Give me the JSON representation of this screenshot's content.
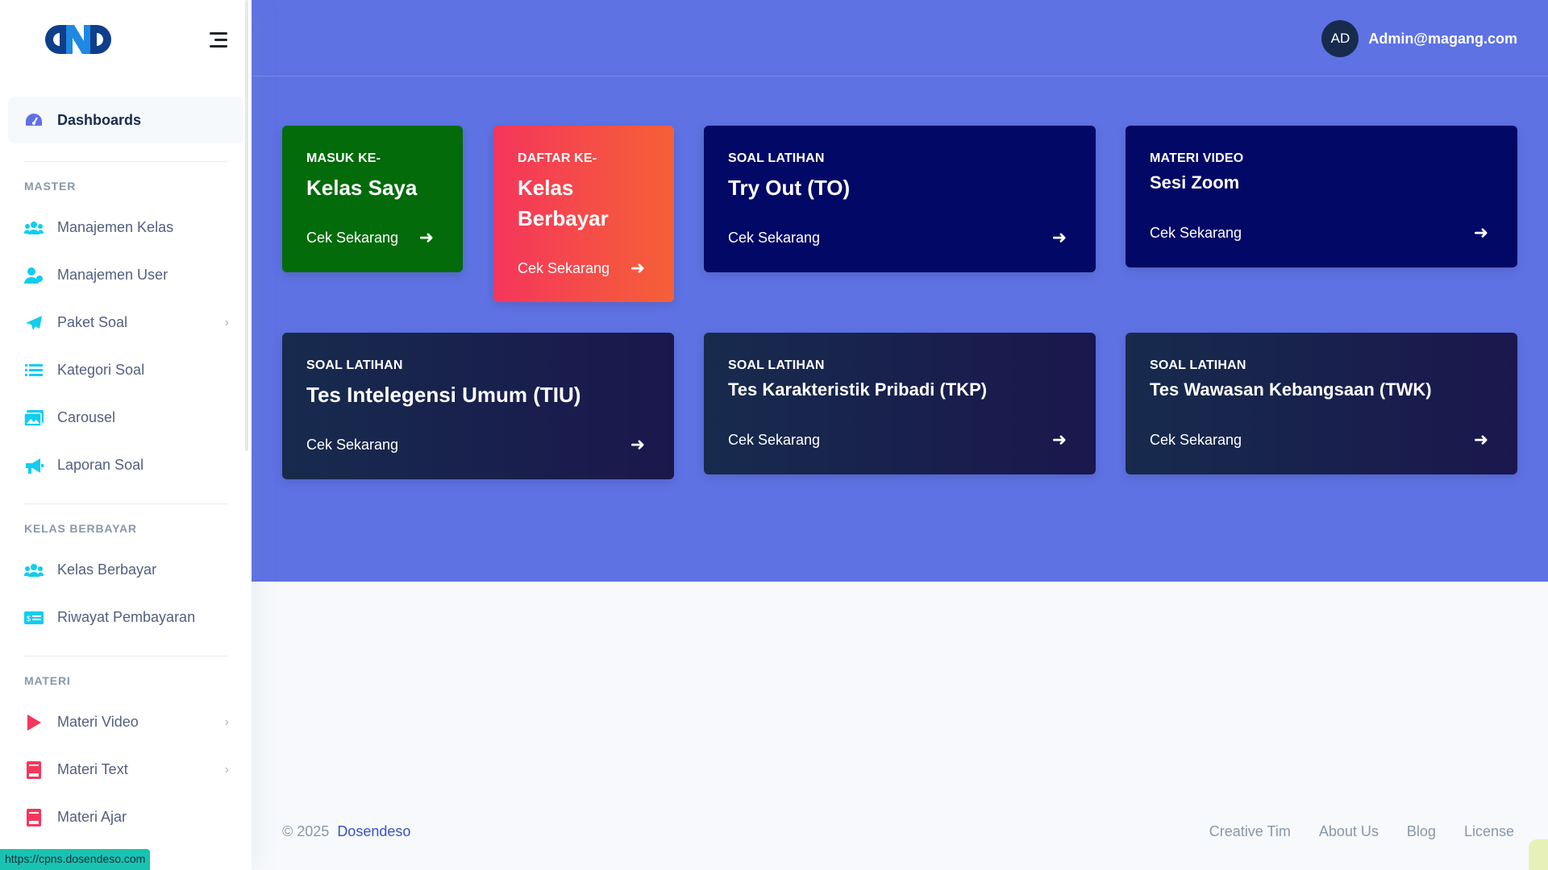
{
  "brand": {
    "logo_text": "DND"
  },
  "sidebar": {
    "active": {
      "label": "Dashboards",
      "icon": "dashboard-gauge-icon"
    },
    "sections": [
      {
        "heading": "MASTER",
        "items": [
          {
            "label": "Manajemen Kelas",
            "icon": "users-group-icon",
            "has_submenu": false
          },
          {
            "label": "Manajemen User",
            "icon": "user-manage-icon",
            "has_submenu": false
          },
          {
            "label": "Paket Soal",
            "icon": "paper-plane-icon",
            "has_submenu": true
          },
          {
            "label": "Kategori Soal",
            "icon": "list-icon",
            "has_submenu": false
          },
          {
            "label": "Carousel",
            "icon": "images-icon",
            "has_submenu": false
          },
          {
            "label": "Laporan Soal",
            "icon": "megaphone-icon",
            "has_submenu": false
          }
        ]
      },
      {
        "heading": "KELAS BERBAYAR",
        "items": [
          {
            "label": "Kelas Berbayar",
            "icon": "users-group-icon",
            "has_submenu": false
          },
          {
            "label": "Riwayat Pembayaran",
            "icon": "money-bill-icon",
            "has_submenu": false
          }
        ]
      },
      {
        "heading": "MATERI",
        "items": [
          {
            "label": "Materi Video",
            "icon": "play-icon",
            "has_submenu": true
          },
          {
            "label": "Materi Text",
            "icon": "book-icon",
            "has_submenu": true
          },
          {
            "label": "Materi Ajar",
            "icon": "book-icon",
            "has_submenu": false
          }
        ]
      }
    ]
  },
  "topbar": {
    "avatar_initials": "AD",
    "user_name": "Admin@magang.com"
  },
  "cards": [
    {
      "pre": "MASUK KE-",
      "title": "Kelas Saya",
      "cta": "Cek Sekarang"
    },
    {
      "pre": "DAFTAR KE-",
      "title_line1": "Kelas",
      "title_line2": "Berbayar",
      "cta": "Cek Sekarang"
    },
    {
      "pre": "SOAL LATIHAN",
      "title": "Try Out (TO)",
      "cta": "Cek Sekarang"
    },
    {
      "pre": "MATERI VIDEO",
      "title": "Sesi Zoom",
      "cta": "Cek Sekarang"
    },
    {
      "pre": "SOAL LATIHAN",
      "title": "Tes Intelegensi Umum (TIU)",
      "cta": "Cek Sekarang"
    },
    {
      "pre": "SOAL LATIHAN",
      "title": "Tes Karakteristik Pribadi (TKP)",
      "cta": "Cek Sekarang"
    },
    {
      "pre": "SOAL LATIHAN",
      "title": "Tes Wawasan Kebangsaan (TWK)",
      "cta": "Cek Sekarang"
    }
  ],
  "footer": {
    "copyright": "© 2025",
    "brand": "Dosendeso",
    "links": [
      "Creative Tim",
      "About Us",
      "Blog",
      "License"
    ]
  },
  "status_url": "https://cpns.dosendeso.com",
  "colors": {
    "primary": "#5e72e4",
    "green_card": "#036b0a",
    "navy_card": "#020866",
    "danger_gradient_start": "#f5365c",
    "danger_gradient_end": "#f56036",
    "dark_card": "#172b4d"
  }
}
